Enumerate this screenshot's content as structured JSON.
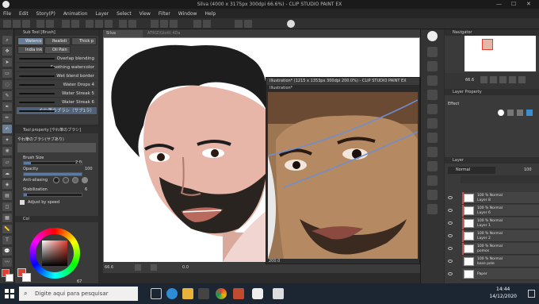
{
  "window": {
    "title": "Silva (4000 x 3175px 300dpi 66.6%) - CLIP STUDIO PAINT EX"
  },
  "menu": [
    "File",
    "Edit",
    "Story(P)",
    "Animation",
    "Layer",
    "Select",
    "View",
    "Filter",
    "Window",
    "Help"
  ],
  "subtool": {
    "header": "Sub Tool [Brush]",
    "tabs": [
      "Waterco",
      "Realisti",
      "Thick p",
      "India ink",
      "Oil Pain"
    ],
    "brushes": [
      "Overlap blending",
      "Soothing watercolor",
      "Wet blend border",
      "Water Drops 4",
      "Water Streak 5",
      "Water Streak 6",
      "やわ筆のブラシ（サブ1ラ）"
    ]
  },
  "toolprop": {
    "header": "Tool property [やわ筆のブラシ]",
    "name": "やわ筆のブラシ(サブあり)",
    "brush_size_label": "Brush Size",
    "brush_size": "2.0",
    "opacity_label": "Opacity",
    "opacity": "100",
    "antialias_label": "Anti-aliasing",
    "stabilization_label": "Stabilization",
    "stabilization": "6",
    "adjust_label": "Adjust by speed"
  },
  "color": {
    "header": "Col",
    "fg": "#e23f30",
    "bg": "#ffffff",
    "value_label": "67"
  },
  "canvas": {
    "tabs": [
      "Silva",
      "ATRIZ/Glotti 4Da"
    ],
    "zoom": "66.6",
    "status": "0.0",
    "coord": "66.6"
  },
  "photo": {
    "title": "Illustration* (1215 x 1353px 300dpi 200.0%) - CLIP STUDIO PAINT EX",
    "tab": "Illustration*",
    "zoom": "200.0"
  },
  "navigator": {
    "header": "Navigator",
    "zoom": "66.6",
    "angle": "0.0"
  },
  "layerprop": {
    "header": "Layer Property",
    "effect": "Effect"
  },
  "layers": {
    "header": "Layer",
    "blend": "Normal",
    "opacity": "100",
    "items": [
      {
        "blend": "100 % Normal",
        "name": "Layer 8"
      },
      {
        "blend": "100 % Normal",
        "name": "Layer 6"
      },
      {
        "blend": "100 % Normal",
        "name": "Layer 1"
      },
      {
        "blend": "100 % Normal",
        "name": "Layer 2"
      },
      {
        "blend": "100 % Normal",
        "name": "pomos"
      },
      {
        "blend": "100 % Normal",
        "name": "base pele"
      },
      {
        "blend": "",
        "name": "Paper"
      }
    ]
  },
  "taskbar": {
    "search_placeholder": "Digite aqui para pesquisar",
    "time": "14:44",
    "date": "14/12/2020"
  },
  "colors": {
    "accent": "#e23f30",
    "taskbar": "#1c2633"
  }
}
